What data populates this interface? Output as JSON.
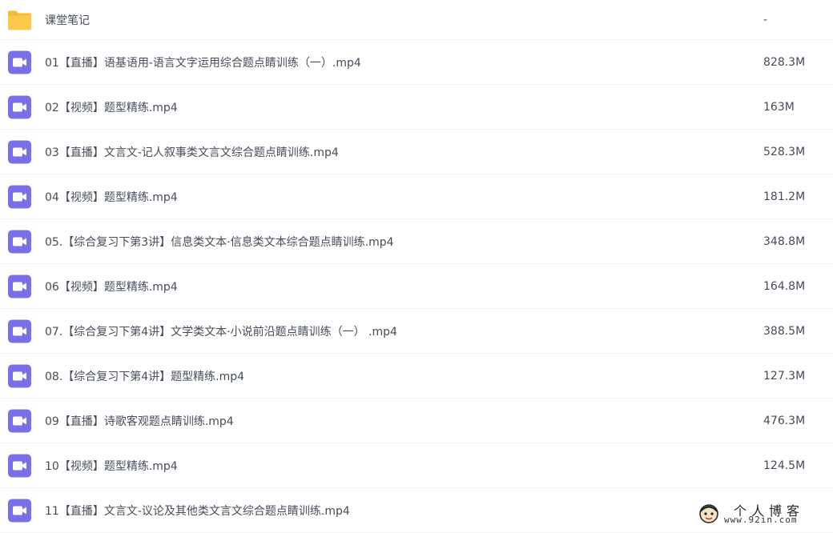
{
  "files": [
    {
      "name": "课堂笔记",
      "size": "-",
      "icon": "folder-icon"
    },
    {
      "name": "01【直播】语基语用-语言文字运用综合题点睛训练（一）.mp4",
      "size": "828.3M",
      "icon": "video-file-icon"
    },
    {
      "name": "02【视频】题型精练.mp4",
      "size": "163M",
      "icon": "video-file-icon"
    },
    {
      "name": "03【直播】文言文-记人叙事类文言文综合题点睛训练.mp4",
      "size": "528.3M",
      "icon": "video-file-icon"
    },
    {
      "name": "04【视频】题型精练.mp4",
      "size": "181.2M",
      "icon": "video-file-icon"
    },
    {
      "name": "05.【综合复习下第3讲】信息类文本·信息类文本综合题点睛训练.mp4",
      "size": "348.8M",
      "icon": "video-file-icon"
    },
    {
      "name": "06【视频】题型精练.mp4",
      "size": "164.8M",
      "icon": "video-file-icon"
    },
    {
      "name": "07.【综合复习下第4讲】文学类文本·小说前沿题点睛训练（一） .mp4",
      "size": "388.5M",
      "icon": "video-file-icon"
    },
    {
      "name": "08.【综合复习下第4讲】题型精练.mp4",
      "size": "127.3M",
      "icon": "video-file-icon"
    },
    {
      "name": "09【直播】诗歌客观题点睛训练.mp4",
      "size": "476.3M",
      "icon": "video-file-icon"
    },
    {
      "name": "10【视频】题型精练.mp4",
      "size": "124.5M",
      "icon": "video-file-icon"
    },
    {
      "name": "11【直播】文言文-议论及其他类文言文综合题点睛训练.mp4",
      "size": "",
      "icon": "video-file-icon"
    }
  ],
  "watermark": {
    "title": "个人博客",
    "url": "www.92in.com"
  },
  "colors": {
    "folder": "#fcc94a",
    "video_icon_bg": "#7b6fe8",
    "text": "#454d5a",
    "divider": "#f1f2f4"
  }
}
